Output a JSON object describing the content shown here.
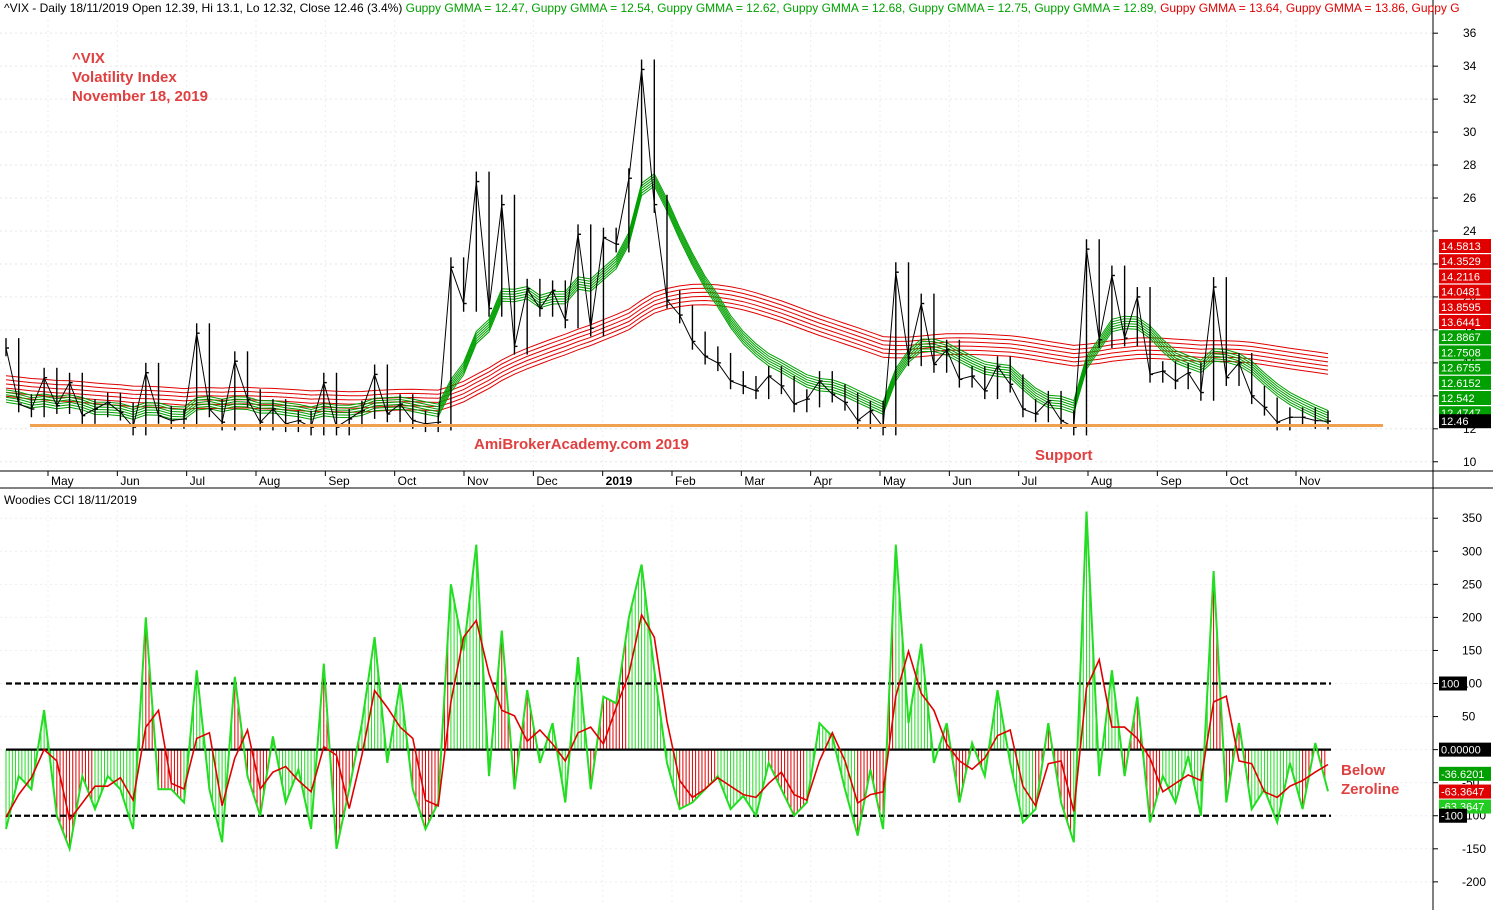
{
  "header": {
    "symbol_line": "^VIX - Daily 18/11/2019 Open 12.39, Hi 13.1, Lo 12.32, Close 12.46 (3.4%)",
    "gmma": [
      {
        "text": "Guppy GMMA = 12.47,",
        "color": "#00a000"
      },
      {
        "text": "Guppy GMMA = 12.54,",
        "color": "#00a000"
      },
      {
        "text": "Guppy GMMA = 12.62,",
        "color": "#00a000"
      },
      {
        "text": "Guppy GMMA = 12.68,",
        "color": "#00a000"
      },
      {
        "text": "Guppy GMMA = 12.75,",
        "color": "#00a000"
      },
      {
        "text": "Guppy GMMA = 12.89,",
        "color": "#00a000"
      },
      {
        "text": "Guppy GMMA = 13.64,",
        "color": "#e00000"
      },
      {
        "text": "Guppy GMMA = 13.86,",
        "color": "#e00000"
      },
      {
        "text": "Guppy G",
        "color": "#e00000"
      }
    ]
  },
  "annotations": {
    "ticker": "^VIX",
    "name": "Volatility Index",
    "date": "November 18, 2019",
    "watermark": "AmiBrokerAcademy.com   2019",
    "support": "Support",
    "below1": "Below",
    "below2": "Zeroline"
  },
  "colors": {
    "green": "#00a000",
    "red": "#e00000",
    "orange": "#f0a050",
    "cci_green": "#22dd22",
    "cci_red": "#e00000"
  },
  "chart_data": [
    {
      "type": "line",
      "title": "^VIX - Daily",
      "x_tick_labels": [
        "May",
        "Jun",
        "Jul",
        "Aug",
        "Sep",
        "Oct",
        "Nov",
        "Dec",
        "2019",
        "Feb",
        "Mar",
        "Apr",
        "May",
        "Jun",
        "Jul",
        "Aug",
        "Sep",
        "Oct",
        "Nov"
      ],
      "y_ticks": [
        10,
        12,
        14,
        16,
        18,
        20,
        22,
        24,
        26,
        28,
        30,
        32,
        34,
        36
      ],
      "ylim": [
        9.5,
        36.8
      ],
      "support_level": 12.2,
      "close_series": [
        16.9,
        13.5,
        13.2,
        15.1,
        13.4,
        14.8,
        12.8,
        13.2,
        13.6,
        13.0,
        12.1,
        15.4,
        12.8,
        12.5,
        12.6,
        17.8,
        13.2,
        12.4,
        16.1,
        13.8,
        12.4,
        13.2,
        12.3,
        12.5,
        12.1,
        14.8,
        12.1,
        12.6,
        13.1,
        15.3,
        12.9,
        13.5,
        12.5,
        12.3,
        12.4,
        21.8,
        19.6,
        27.0,
        19.3,
        25.6,
        17.0,
        20.5,
        19.3,
        20.4,
        18.6,
        23.8,
        18.1,
        23.6,
        23.2,
        27.2,
        33.8,
        25.6,
        19.8,
        18.9,
        17.3,
        16.4,
        16.0,
        14.9,
        14.6,
        14.3,
        15.2,
        14.6,
        13.5,
        13.8,
        14.9,
        14.1,
        13.6,
        12.5,
        13.1,
        12.1,
        21.5,
        16.3,
        19.6,
        15.9,
        16.8,
        15.0,
        15.2,
        14.3,
        15.8,
        14.7,
        13.2,
        12.9,
        13.7,
        12.5,
        12.1,
        22.9,
        17.4,
        21.3,
        17.5,
        20.0,
        15.3,
        15.5,
        14.9,
        15.4,
        14.2,
        20.6,
        15.1,
        16.0,
        14.0,
        13.3,
        12.4,
        12.7,
        12.7,
        12.5,
        12.46
      ],
      "ema_green": [
        13.91,
        13.79,
        13.58,
        13.66,
        13.52,
        13.61,
        13.45,
        13.17,
        13.16,
        13.09,
        12.87,
        13.14,
        13.12,
        12.9,
        12.87,
        13.44,
        13.51,
        13.34,
        13.5,
        13.47,
        13.25,
        13.26,
        13.13,
        13.03,
        12.87,
        13.08,
        12.99,
        12.98,
        13.11,
        13.4,
        13.44,
        13.48,
        13.35,
        13.19,
        13.04,
        14.54,
        15.57,
        17.46,
        18.18,
        20.04,
        20.01,
        20.18,
        19.64,
        19.87,
        19.88,
        20.77,
        20.64,
        21.33,
        22.01,
        23.47,
        26.45,
        27.02,
        25.5,
        23.77,
        22.21,
        20.81,
        19.69,
        18.43,
        17.45,
        16.71,
        16.11,
        15.71,
        15.26,
        14.83,
        14.6,
        14.53,
        14.26,
        13.89,
        13.53,
        13.18,
        15.2,
        16.32,
        16.99,
        16.99,
        16.77,
        16.36,
        15.96,
        15.62,
        15.48,
        15.39,
        14.68,
        14.02,
        13.59,
        13.52,
        13.26,
        15.91,
        17.05,
        18.19,
        18.38,
        18.34,
        17.79,
        16.97,
        16.3,
        15.99,
        15.71,
        16.4,
        16.34,
        16.12,
        15.65,
        14.94,
        14.29,
        13.76,
        13.36,
        12.99,
        12.66
      ],
      "ema_red": [
        13.97,
        13.89,
        13.8,
        13.75,
        13.68,
        13.66,
        13.6,
        13.53,
        13.47,
        13.42,
        13.34,
        13.33,
        13.3,
        13.25,
        13.19,
        13.24,
        13.25,
        13.22,
        13.26,
        13.26,
        13.22,
        13.2,
        13.16,
        13.11,
        13.05,
        13.07,
        13.03,
        13.0,
        13.01,
        13.07,
        13.11,
        13.14,
        13.15,
        13.12,
        13.1,
        13.34,
        13.63,
        14.05,
        14.45,
        14.93,
        15.31,
        15.64,
        15.93,
        16.22,
        16.49,
        16.79,
        17.05,
        17.37,
        17.68,
        18.01,
        18.55,
        19.01,
        19.26,
        19.42,
        19.51,
        19.53,
        19.48,
        19.37,
        19.21,
        19.0,
        18.76,
        18.51,
        18.23,
        17.94,
        17.66,
        17.4,
        17.14,
        16.88,
        16.61,
        16.34,
        16.3,
        16.31,
        16.38,
        16.45,
        16.51,
        16.52,
        16.51,
        16.48,
        16.44,
        16.4,
        16.3,
        16.18,
        16.05,
        15.93,
        15.81,
        15.88,
        15.97,
        16.1,
        16.18,
        16.26,
        16.27,
        16.24,
        16.19,
        16.14,
        16.08,
        16.1,
        16.09,
        16.06,
        15.99,
        15.88,
        15.76,
        15.64,
        15.53,
        15.42,
        15.31
      ],
      "price_tags": [
        {
          "text": "14.5813",
          "bg": "#e00000"
        },
        {
          "text": "14.3529",
          "bg": "#e00000"
        },
        {
          "text": "14.2116",
          "bg": "#e00000"
        },
        {
          "text": "14.0481",
          "bg": "#e00000"
        },
        {
          "text": "13.8595",
          "bg": "#e00000"
        },
        {
          "text": "13.6441",
          "bg": "#e00000"
        },
        {
          "text": "12.8867",
          "bg": "#00a000"
        },
        {
          "text": "12.7508",
          "bg": "#00a000"
        },
        {
          "text": "12.6755",
          "bg": "#00a000"
        },
        {
          "text": "12.6152",
          "bg": "#00a000"
        },
        {
          "text": "12.542",
          "bg": "#00a000"
        },
        {
          "text": "12.4747",
          "bg": "#00a000"
        },
        {
          "text": "12.46",
          "bg": "#000000"
        }
      ]
    },
    {
      "type": "line",
      "title": "Woodies CCI  18/11/2019",
      "y_ticks": [
        -200,
        -150,
        -100,
        -50,
        0,
        50,
        100,
        150,
        200,
        250,
        300,
        350
      ],
      "ylim": [
        -235,
        370
      ],
      "reference_lines": [
        100,
        0,
        -100
      ],
      "cci_series": [
        -120,
        -40,
        -60,
        60,
        -100,
        -150,
        -40,
        -90,
        -40,
        -60,
        -120,
        200,
        -60,
        -60,
        -80,
        120,
        -60,
        -140,
        110,
        -40,
        -100,
        20,
        -80,
        -30,
        -120,
        130,
        -150,
        -60,
        40,
        170,
        -20,
        100,
        -60,
        -120,
        -80,
        250,
        150,
        310,
        -40,
        180,
        -60,
        90,
        -20,
        40,
        -80,
        140,
        -60,
        80,
        70,
        200,
        280,
        120,
        -20,
        -90,
        -80,
        -60,
        -40,
        -90,
        -70,
        -100,
        -20,
        -60,
        -100,
        -80,
        40,
        20,
        -60,
        -130,
        -30,
        -120,
        310,
        40,
        160,
        -20,
        40,
        -80,
        10,
        -40,
        90,
        -20,
        -110,
        -90,
        40,
        -80,
        -140,
        360,
        -40,
        120,
        -40,
        80,
        -110,
        -40,
        -80,
        -10,
        -100,
        270,
        -80,
        40,
        -90,
        -60,
        -110,
        -20,
        -90,
        10,
        -63
      ],
      "cci_tags": [
        {
          "text": "100",
          "bg": "#000000"
        },
        {
          "text": "0.00000",
          "bg": "#000000"
        },
        {
          "text": "-36.6201",
          "bg": "#00a000"
        },
        {
          "text": "-63.3647",
          "bg": "#e00000"
        },
        {
          "text": "-63.3647",
          "bg": "#22cc22"
        },
        {
          "text": "-100",
          "bg": "#000000"
        }
      ]
    }
  ]
}
